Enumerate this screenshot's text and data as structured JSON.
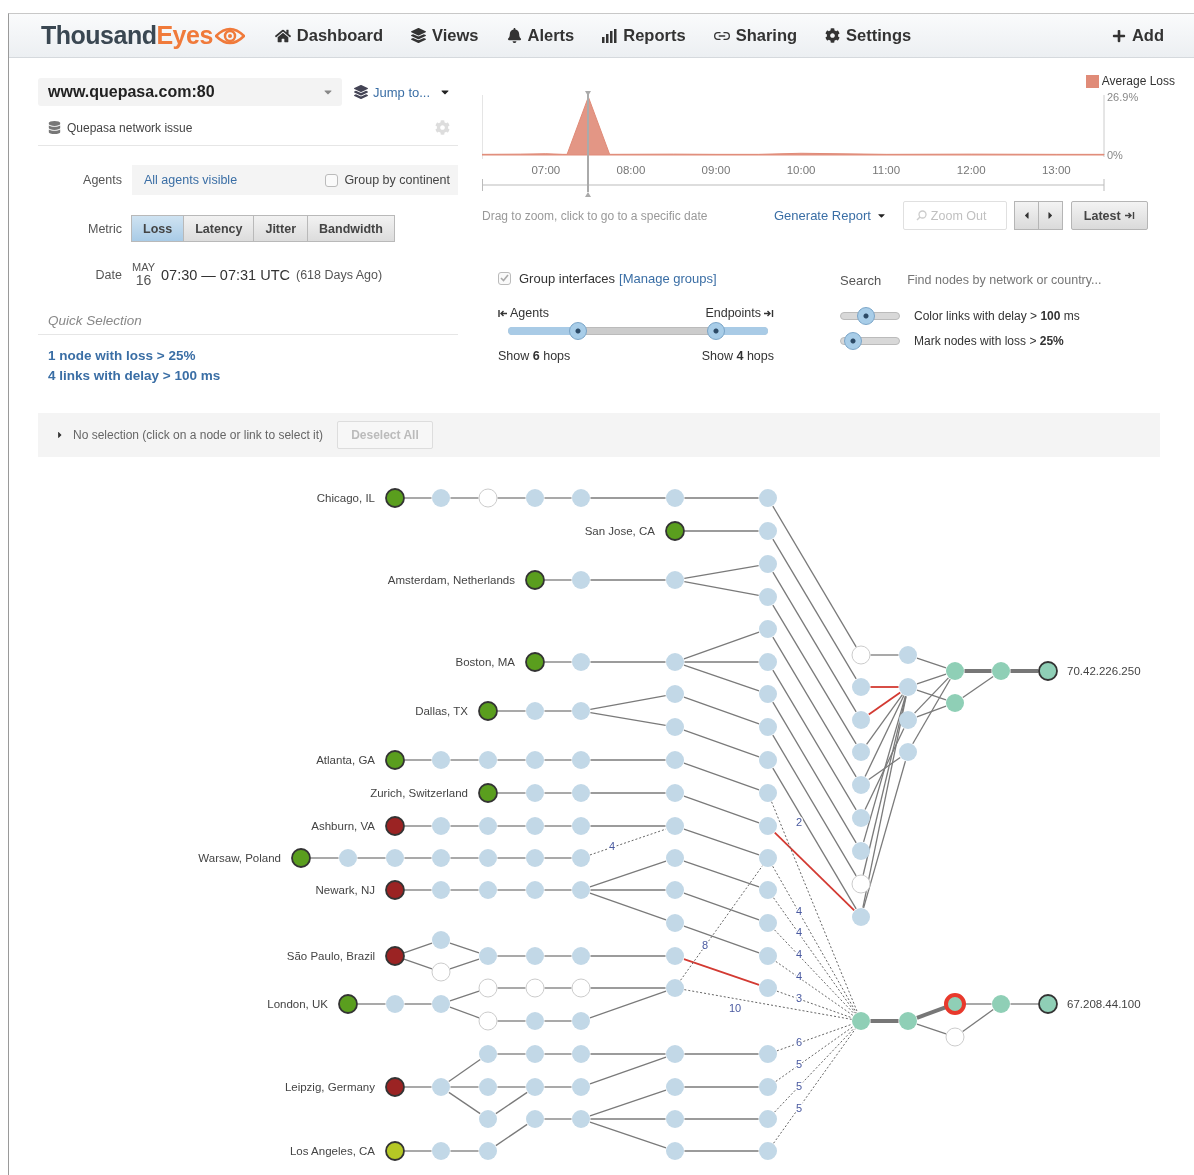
{
  "header": {
    "logo": {
      "first": "Thousand",
      "second": "Eyes"
    },
    "nav": [
      {
        "kind": "home",
        "label": "Dashboard"
      },
      {
        "kind": "layers",
        "label": "Views"
      },
      {
        "kind": "bell",
        "label": "Alerts"
      },
      {
        "kind": "bars",
        "label": "Reports"
      },
      {
        "kind": "link",
        "label": "Sharing"
      },
      {
        "kind": "gear",
        "label": "Settings"
      }
    ],
    "add": "Add"
  },
  "test": {
    "url": "www.quepasa.com:80",
    "jump": "Jump to...",
    "description": "Quepasa network issue"
  },
  "agents": {
    "label": "Agents",
    "value": "All agents visible",
    "group_by_continent": {
      "label": "Group by continent",
      "checked": false
    }
  },
  "metric": {
    "label": "Metric",
    "options": [
      {
        "label": "Loss",
        "selected": true
      },
      {
        "label": "Latency",
        "selected": false
      },
      {
        "label": "Jitter",
        "selected": false
      },
      {
        "label": "Bandwidth",
        "selected": false
      }
    ]
  },
  "date": {
    "label": "Date",
    "month": "MAY",
    "day": "16",
    "range": "07:30 — 07:31 UTC",
    "ago": "(618 Days Ago)"
  },
  "quick_selection": {
    "title": "Quick Selection",
    "links": [
      "1 node with loss > 25%",
      "4 links with delay > 100 ms"
    ]
  },
  "timeline": {
    "chart_data": {
      "type": "area",
      "series": [
        {
          "name": "Average Loss",
          "color": "#e08b78",
          "values": [
            0.3,
            0.4,
            0.6,
            0.3,
            0.3,
            26.9,
            0.3,
            0.4,
            0.3,
            0.3,
            0.8,
            0.3,
            0.4,
            0.3,
            0.3
          ]
        }
      ],
      "x": [
        6.25,
        6.7,
        7.0,
        7.2,
        7.25,
        7.5,
        7.75,
        8.5,
        9.0,
        9.5,
        10.0,
        11.0,
        12.0,
        13.0,
        13.56
      ],
      "xlim": [
        6.25,
        13.56
      ],
      "ylim": [
        0,
        26.9
      ],
      "xticks": [
        {
          "value": 7,
          "label": "07:00"
        },
        {
          "value": 8,
          "label": "08:00"
        },
        {
          "value": 9,
          "label": "09:00"
        },
        {
          "value": 10,
          "label": "10:00"
        },
        {
          "value": 11,
          "label": "11:00"
        },
        {
          "value": 12,
          "label": "12:00"
        },
        {
          "value": 13,
          "label": "13:00"
        }
      ],
      "yticks": [
        {
          "value": 0,
          "label": "0%"
        },
        {
          "value": 26.9,
          "label": "26.9%"
        }
      ]
    },
    "hint": "Drag to zoom, click to go to a specific date",
    "generate_report": "Generate Report",
    "zoom_out": {
      "label": "Zoom Out",
      "disabled": true
    },
    "latest": "Latest"
  },
  "view_options": {
    "group_interfaces": {
      "label": "Group interfaces",
      "checked": true,
      "manage": "[Manage groups]"
    },
    "search": {
      "label": "Search",
      "placeholder": "Find nodes by network or country..."
    },
    "hops": {
      "agents": {
        "label": "Agents",
        "caption": "Show **6** hops",
        "level": 0.27
      },
      "endpoints": {
        "label": "Endpoints",
        "caption": "Show **4** hops"
      }
    },
    "filters": [
      {
        "label": "Color links with delay > **100** ms",
        "level": 0.43
      },
      {
        "label": "Mark nodes with loss > **25%**",
        "level": 0.22
      }
    ]
  },
  "selection": {
    "text": "No selection (click on a node or link to select it)",
    "deselect": {
      "label": "Deselect All",
      "disabled": true
    }
  },
  "path_view": {
    "agents": [
      {
        "name": "Chicago, IL",
        "color": "#5a9e1e"
      },
      {
        "name": "San Jose, CA",
        "color": "#5a9e1e"
      },
      {
        "name": "Amsterdam, Netherlands",
        "color": "#5a9e1e"
      },
      {
        "name": "Boston, MA",
        "color": "#5a9e1e"
      },
      {
        "name": "Dallas, TX",
        "color": "#5a9e1e"
      },
      {
        "name": "Atlanta, GA",
        "color": "#5a9e1e"
      },
      {
        "name": "Zurich, Switzerland",
        "color": "#5a9e1e"
      },
      {
        "name": "Ashburn, VA",
        "color": "#9b2323"
      },
      {
        "name": "Warsaw, Poland",
        "color": "#5a9e1e"
      },
      {
        "name": "Newark, NJ",
        "color": "#9b2323"
      },
      {
        "name": "São Paulo, Brazil",
        "color": "#9b2323"
      },
      {
        "name": "London, UK",
        "color": "#5a9e1e"
      },
      {
        "name": "Leipzig, Germany",
        "color": "#9b2323"
      },
      {
        "name": "Los Angeles, CA",
        "color": "#b5c825"
      }
    ],
    "endpoints": [
      "70.42.226.250",
      "67.208.44.100"
    ],
    "link_labels": [
      "2",
      "4",
      "4",
      "4",
      "8",
      "4",
      "4",
      "3",
      "10",
      "6",
      "5",
      "5",
      "5"
    ]
  }
}
